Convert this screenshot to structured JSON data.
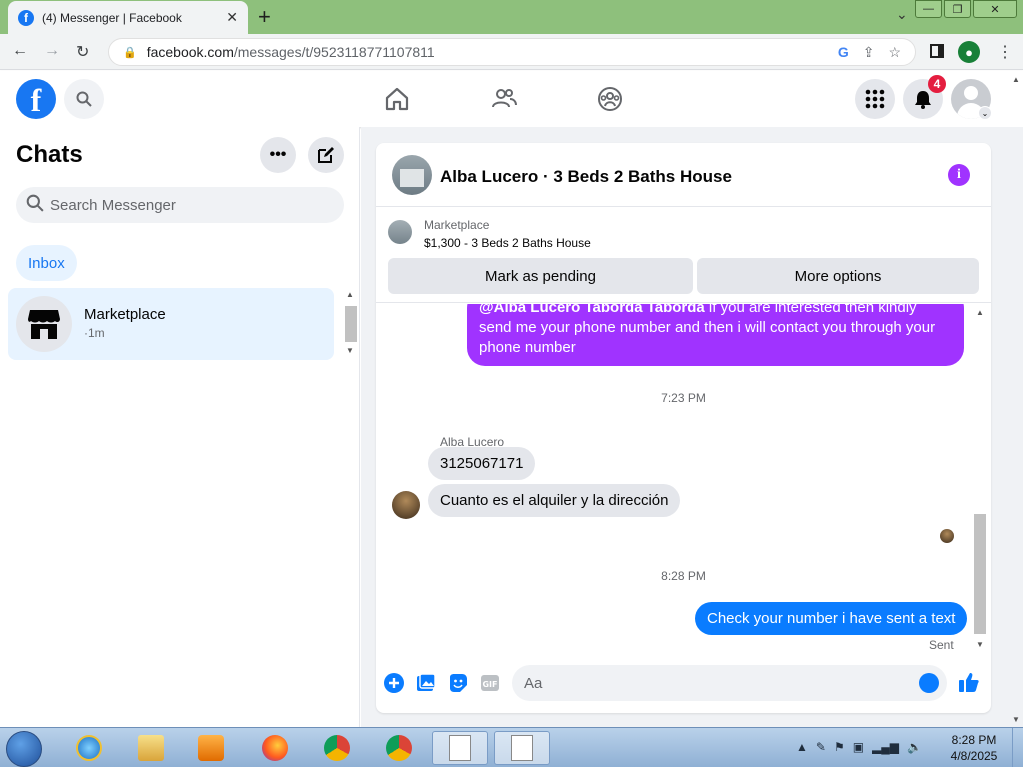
{
  "browser": {
    "tab_title": "(4) Messenger | Facebook",
    "tab_close": "✕",
    "new_tab": "+",
    "url_host": "facebook.com",
    "url_path": "/messages/t/9523118771107811"
  },
  "facebook": {
    "logo": "f",
    "notification_count": "4"
  },
  "sidebar": {
    "title": "Chats",
    "search_placeholder": "Search Messenger",
    "filter_label": "Inbox",
    "chats": [
      {
        "name": "Marketplace",
        "time": "·1m"
      }
    ]
  },
  "conversation": {
    "title": "Alba Lucero · 3 Beds 2 Baths House",
    "marketplace_label": "Marketplace",
    "listing": "$1,300 - 3 Beds 2 Baths House",
    "mark_pending_label": "Mark as pending",
    "more_options_label": "More options",
    "messages": {
      "outgoing_mention": "@Alba Lucero Taborda Taborda",
      "outgoing_text": " if you are interested then kindly send me your phone number and then i will contact you through your phone number",
      "time_1": "7:23 PM",
      "sender_name": "Alba Lucero",
      "incoming_1": "3125067171",
      "incoming_2": "Cuanto es el alquiler y la dirección",
      "time_2": "8:28 PM",
      "outgoing_2": "Check your number i have sent a text",
      "status": "Sent"
    },
    "composer_placeholder": "Aa"
  },
  "taskbar": {
    "time": "8:28 PM",
    "date": "4/8/2025"
  },
  "colors": {
    "fb_blue": "#1877f2",
    "messenger_purple": "#a033ff",
    "messenger_blue": "#0a7cff"
  }
}
